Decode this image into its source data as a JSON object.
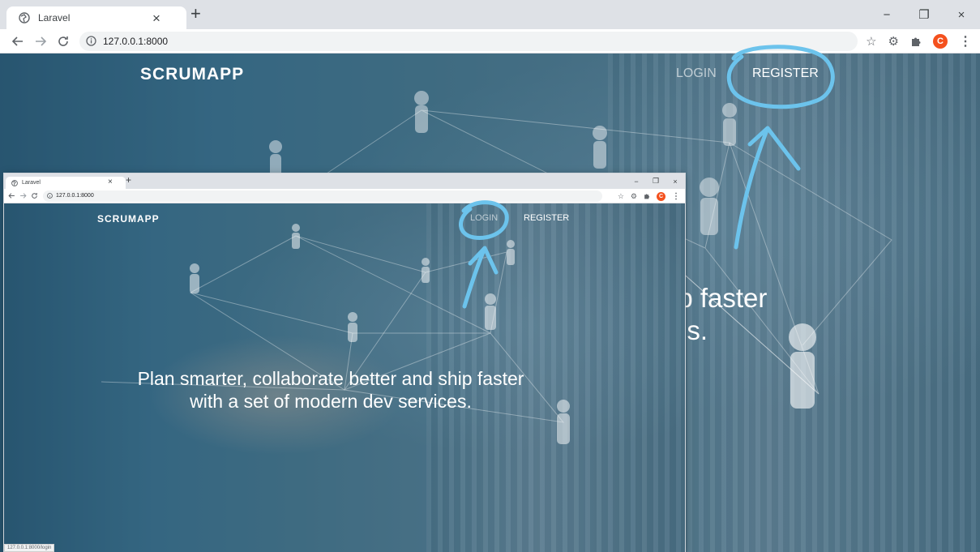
{
  "background_window": {
    "tab_title": "Laravel",
    "tab_close": "×",
    "new_tab": "+",
    "controls": {
      "minimize": "−",
      "restore": "❐",
      "close": "×"
    },
    "url": "127.0.0.1:8000",
    "avatar_letter": "C",
    "brand": "SCRUMAPP",
    "nav": {
      "login": "LOGIN",
      "register": "REGISTER"
    },
    "headline_line1": "ip faster",
    "headline_line2": "es."
  },
  "foreground_window": {
    "tab_title": "Laravel",
    "tab_close": "×",
    "new_tab": "+",
    "controls": {
      "minimize": "−",
      "restore": "❐",
      "close": "×"
    },
    "url": "127.0.0.1:8000",
    "avatar_letter": "C",
    "brand": "SCRUMAPP",
    "nav": {
      "login": "LOGIN",
      "register": "REGISTER"
    },
    "headline_line1": "Plan smarter, collaborate better and ship faster",
    "headline_line2": "with a set of modern dev services.",
    "status_url": "127.0.0.1:8000/login"
  },
  "colors": {
    "annotation": "#6cc3ec",
    "avatar": "#f4511e",
    "tabstrip": "#dee1e6"
  },
  "icons": [
    "globe-icon",
    "back-arrow-icon",
    "forward-arrow-icon",
    "reload-icon",
    "info-icon",
    "star-icon",
    "gear-extension-icon",
    "puzzle-extension-icon",
    "menu-dots-icon"
  ]
}
